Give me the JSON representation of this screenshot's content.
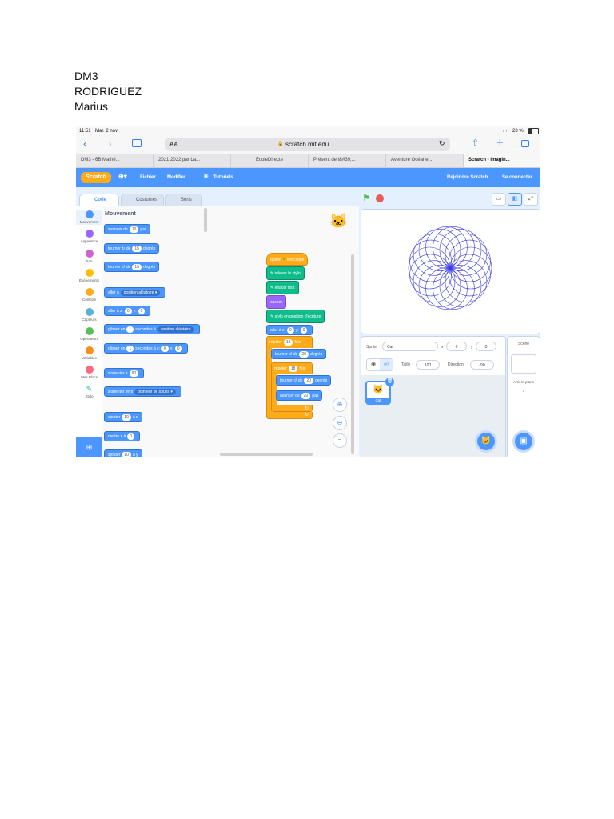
{
  "heading": {
    "line1": "DM3",
    "line2": "RODRIGUEZ",
    "line3": "Marius"
  },
  "status": {
    "time": "11:51",
    "date": "Mar. 2 nov.",
    "battery": "28 %"
  },
  "safari": {
    "text_size": "AA",
    "url": "scratch.mit.edu"
  },
  "browser_tabs": [
    {
      "label": "DM3 - 6B Mathé..."
    },
    {
      "label": "2021 2022 par La..."
    },
    {
      "label": "EcoleDirecte"
    },
    {
      "label": "Présent de l&#39;..."
    },
    {
      "label": "Aventure Océane..."
    },
    {
      "label": "Scratch - Imagin..."
    }
  ],
  "menubar": {
    "logo": "Scratch",
    "file": "Fichier",
    "edit": "Modifier",
    "tutorials": "Tutoriels",
    "join": "Rejoindre Scratch",
    "login": "Se connecter"
  },
  "editor_tabs": {
    "code": "Code",
    "costumes": "Costumes",
    "sounds": "Sons"
  },
  "categories": [
    {
      "label": "Mouvement",
      "color": "#4c97ff"
    },
    {
      "label": "Apparence",
      "color": "#9966ff"
    },
    {
      "label": "Son",
      "color": "#cf63cf"
    },
    {
      "label": "Événements",
      "color": "#ffbf00"
    },
    {
      "label": "Contrôle",
      "color": "#ffab19"
    },
    {
      "label": "Capteurs",
      "color": "#5cb1d6"
    },
    {
      "label": "Opérateurs",
      "color": "#59c059"
    },
    {
      "label": "Variables",
      "color": "#ff8c1a"
    },
    {
      "label": "Mes Blocs",
      "color": "#ff6680"
    },
    {
      "label": "Stylo",
      "color": "#0fbd8c"
    }
  ],
  "palette": {
    "title": "Mouvement",
    "move": {
      "a": "avancer de",
      "v": "10",
      "b": "pas"
    },
    "turn_right": {
      "a": "tourner",
      "b": "de",
      "v": "15",
      "c": "degrés"
    },
    "turn_left": {
      "a": "tourner",
      "b": "de",
      "v": "15",
      "c": "degrés"
    },
    "goto": {
      "a": "aller à",
      "dd": "position aléatoire"
    },
    "goto_xy": {
      "a": "aller à x:",
      "x": "0",
      "b": "y:",
      "y": "0"
    },
    "glide": {
      "a": "glisser en",
      "v": "1",
      "b": "secondes à",
      "dd": "position aléatoire"
    },
    "glide_xy": {
      "a": "glisser en",
      "v": "1",
      "b": "secondes à x:",
      "x": "0",
      "c": "y:",
      "y": "0"
    },
    "point": {
      "a": "s'orienter à",
      "v": "90"
    },
    "point_towards": {
      "a": "s'orienter vers",
      "dd": "pointeur de souris"
    },
    "change_x": {
      "a": "ajouter",
      "v": "10",
      "b": "à x"
    },
    "set_x": {
      "a": "mettre x à",
      "v": "0"
    },
    "change_y": {
      "a": "ajouter",
      "v": "10",
      "b": "à y"
    }
  },
  "script": {
    "when_flag": "quand",
    "when_flag2": "est cliqué",
    "pen_up": "relever le stylo",
    "clear": "effacer tout",
    "hide": "cacher",
    "pen_down": "stylo en position d'écriture",
    "goto": {
      "a": "aller à x:",
      "x": "0",
      "b": "y:",
      "y": "0"
    },
    "repeat1": {
      "a": "répéter",
      "v": "18",
      "b": "fois"
    },
    "turn": {
      "a": "tourner",
      "b": "de",
      "v": "20",
      "c": "degrés"
    },
    "repeat2": {
      "a": "répéter",
      "v": "18",
      "b": "fois"
    },
    "turn2": {
      "a": "tourner",
      "b": "de",
      "v": "20",
      "c": "degrés"
    },
    "move": {
      "a": "avancer de",
      "v": "20",
      "b": "pas"
    }
  },
  "sprite": {
    "label_sprite": "Sprite",
    "name": "Cat",
    "label_x": "x",
    "x": "0",
    "label_y": "y",
    "y": "0",
    "label_size": "Taille",
    "size": "100",
    "label_direction": "Direction",
    "direction": "-90",
    "thumb_name": "Cat"
  },
  "scene": {
    "title": "Scène",
    "backdrops_label": "Arrière-plans",
    "backdrops_count": "1"
  },
  "colors": {
    "scratch_blue": "#4c97ff",
    "control": "#ffab19",
    "pen": "#0fbd8c",
    "looks": "#9966ff",
    "rosette": "#3a3ae0"
  }
}
